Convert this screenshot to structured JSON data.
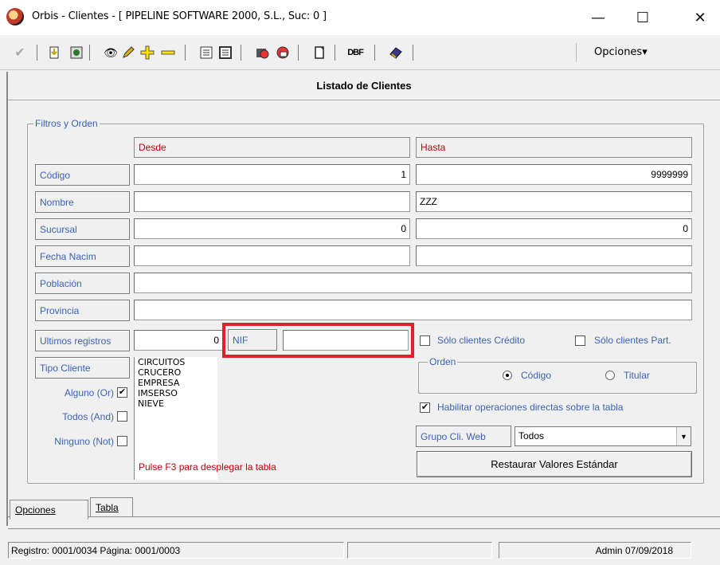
{
  "window": {
    "title": "Orbis - Clientes - [ PIPELINE SOFTWARE 2000, S.L.,  Suc: 0 ]",
    "minimize": "—",
    "maximize": "☐",
    "close": "✕"
  },
  "toolbar": {
    "opciones_label": "Opciones▾",
    "dbf_label": "DBF"
  },
  "header": {
    "title": "Listado de Clientes"
  },
  "filters": {
    "group_label": "Filtros y Orden",
    "col_desde": "Desde",
    "col_hasta": "Hasta",
    "rows": {
      "codigo": {
        "label": "Código",
        "desde": "1",
        "hasta": "9999999"
      },
      "nombre": {
        "label": "Nombre",
        "desde": "",
        "hasta": "ZZZ"
      },
      "sucursal": {
        "label": "Sucursal",
        "desde": "0",
        "hasta": "0"
      },
      "fecha_nacim": {
        "label": "Fecha Nacim",
        "desde": "",
        "hasta": ""
      },
      "poblacion": {
        "label": "Población",
        "value": ""
      },
      "provincia": {
        "label": "Provincia",
        "value": ""
      },
      "ultimos": {
        "label": "Ultimos registros",
        "value": "0"
      }
    },
    "nif": {
      "label": "NIF",
      "value": ""
    },
    "solo_credito": {
      "label": "Sólo clientes Crédito",
      "checked": false
    },
    "solo_part": {
      "label": "Sólo clientes Part.",
      "checked": false
    },
    "tipo_cliente": {
      "label": "Tipo Cliente",
      "items": [
        "CIRCUITOS",
        "CRUCERO",
        "EMPRESA",
        "IMSERSO",
        "NIEVE"
      ]
    },
    "alguno": {
      "label": "Alguno (Or)",
      "checked": true
    },
    "todos": {
      "label": "Todos (And)",
      "checked": false
    },
    "ninguno": {
      "label": "Ninguno (Not)",
      "checked": false
    },
    "orden": {
      "label": "Orden",
      "codigo": "Código",
      "titular": "Titular",
      "selected": "codigo"
    },
    "habilitar": {
      "label": "Habilitar operaciones directas sobre la tabla",
      "checked": true
    },
    "grupo_web": {
      "label": "Grupo Cli. Web",
      "value": "Todos"
    },
    "restaurar_label": "Restaurar Valores Estándar",
    "hint": "Pulse F3 para desplegar la tabla"
  },
  "tabs": {
    "opciones": "Opciones",
    "tabla": "Tabla"
  },
  "status": {
    "registro": "Registro: 0001/0034  Página: 0001/0003",
    "user_date": "Admin 07/09/2018"
  }
}
